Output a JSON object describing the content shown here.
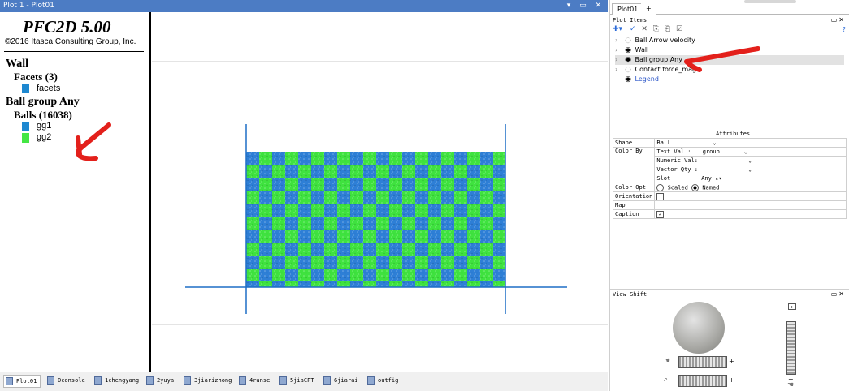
{
  "window": {
    "title": "Plot 1 - Plot01",
    "controls": "▾ ▭ ✕"
  },
  "legend": {
    "title": "PFC2D 5.00",
    "copyright": "©2016 Itasca Consulting Group, Inc.",
    "wall_header": "Wall",
    "facets_header": "Facets (3)",
    "facets_label": "facets",
    "ballgroup_header": "Ball group Any",
    "balls_header": "Balls (16038)",
    "groups": [
      {
        "label": "gg1",
        "color": "#1e88d0"
      },
      {
        "label": "gg2",
        "color": "#44e644"
      }
    ],
    "facet_color": "#1e88d0"
  },
  "plot": {
    "colors": {
      "blue": "#2e7fd6",
      "green": "#3fe23f",
      "wall": "#1f6fc5"
    }
  },
  "dock": {
    "tab_active": "Plot01",
    "tab_add": "+",
    "plot_items_title": "Plot Items",
    "toolbar_icons": [
      "add-icon",
      "check-icon",
      "delete-icon",
      "copy-icon",
      "paste-icon",
      "checkbox-icon"
    ],
    "help": "?",
    "items": [
      {
        "label": "Ball Arrow velocity",
        "visible": false,
        "expandable": true
      },
      {
        "label": "Wall",
        "visible": true,
        "expandable": true
      },
      {
        "label": "Ball group Any",
        "visible": true,
        "expandable": true,
        "selected": true
      },
      {
        "label": "Contact force_mag",
        "visible": false,
        "expandable": true
      },
      {
        "label": "Legend",
        "visible": true,
        "expandable": false,
        "link": true
      }
    ],
    "attributes_title": "Attributes",
    "attributes": {
      "shape_label": "Shape",
      "shape_value": "Ball",
      "color_by_label": "Color By",
      "text_val_label": "Text Val",
      "text_val_value": "group",
      "numeric_val_label": "Numeric Val",
      "vector_qty_label": "Vector Qty",
      "slot_label": "Slot",
      "slot_value": "Any",
      "color_opt_label": "Color Opt",
      "scaled_label": "Scaled",
      "named_label": "Named",
      "orientation_label": "Orientation",
      "map_label": "Map",
      "caption_label": "Caption"
    },
    "view_shift_title": "View Shift"
  },
  "bottom_tabs": [
    "Plot01",
    "0console",
    "1chengyang",
    "2yuya",
    "3jiarizhong",
    "4ranse",
    "5jiaCPT",
    "6jiarai",
    "outfig"
  ]
}
